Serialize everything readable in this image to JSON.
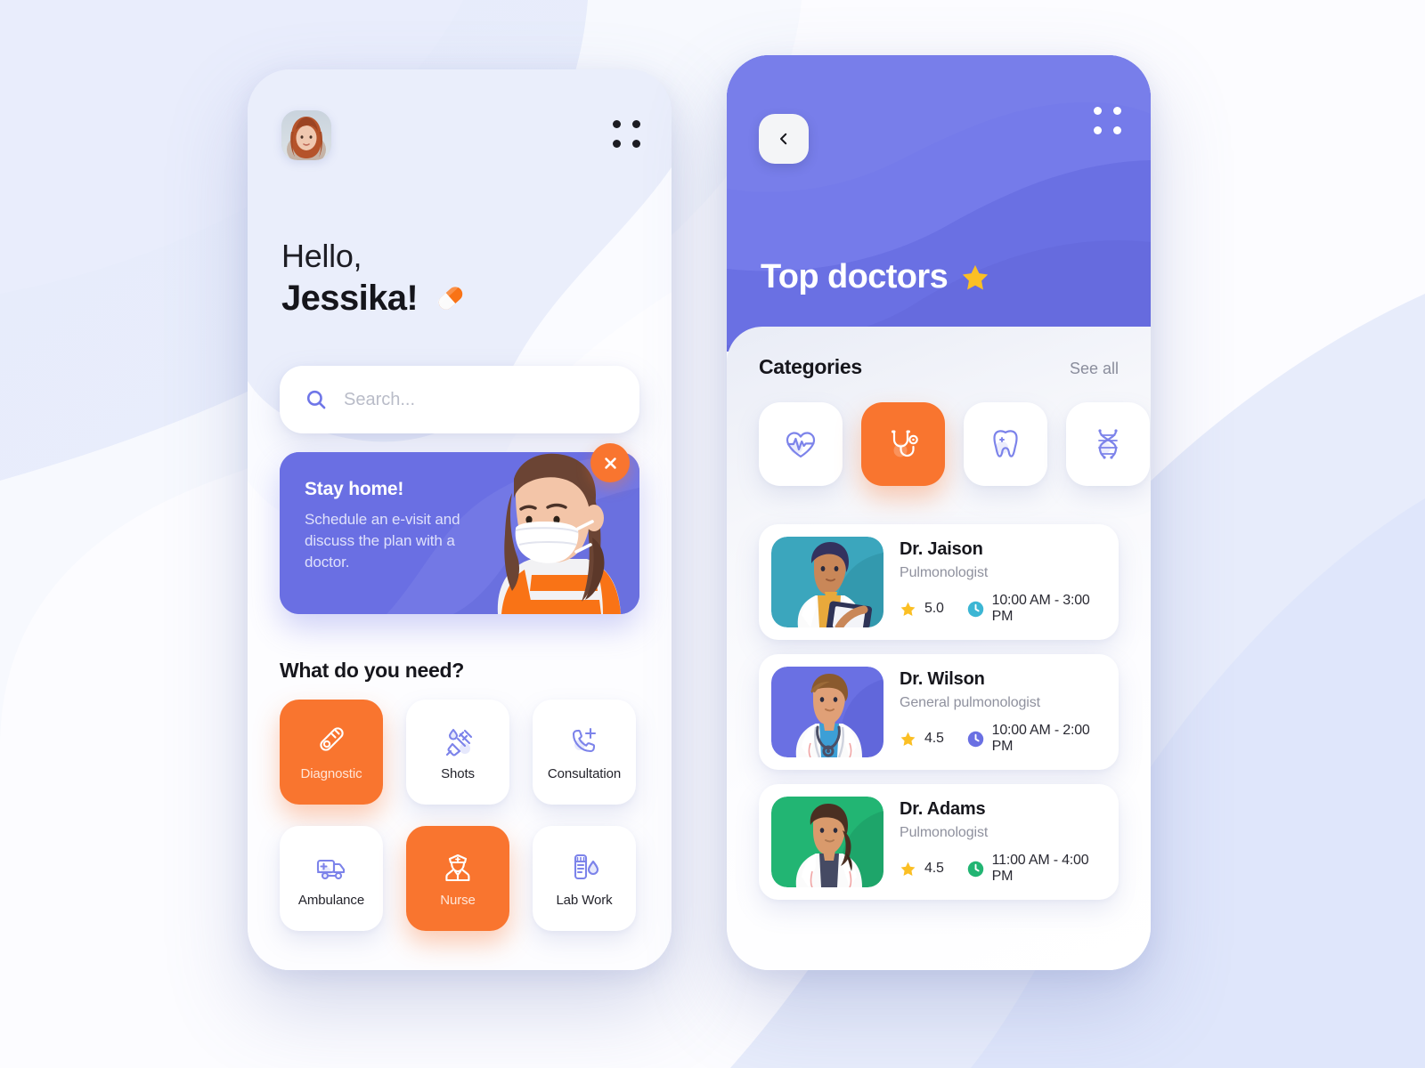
{
  "theme": {
    "background": "#e6ebfb",
    "purple": "#6a70e3",
    "orange": "#f9752f",
    "indigo_icon": "#6f76e8",
    "star_yellow": "#fbbf24",
    "text_dark": "#17171d",
    "text_muted": "#8f919e"
  },
  "left_phone": {
    "avatar_name": "user-avatar-photo",
    "menu_icon": "grid-dots-icon",
    "greeting": {
      "line1": "Hello,",
      "name": "Jessika!",
      "emoji_icon": "pill-icon"
    },
    "search": {
      "placeholder": "Search...",
      "value": "",
      "icon": "search-icon"
    },
    "banner": {
      "title": "Stay home!",
      "subtitle": "Schedule an e-visit and discuss the plan with a doctor.",
      "close_icon": "close-icon",
      "illustration": "masked-girl-illustration"
    },
    "needs_section": {
      "title": "What do you need?",
      "tiles": [
        {
          "label": "Diagnostic",
          "icon": "thermometer-icon",
          "active": true
        },
        {
          "label": "Shots",
          "icon": "syringe-icon",
          "active": false
        },
        {
          "label": "Consultation",
          "icon": "phone-plus-icon",
          "active": false
        },
        {
          "label": "Ambulance",
          "icon": "ambulance-icon",
          "active": false
        },
        {
          "label": "Nurse",
          "icon": "nurse-icon",
          "active": true
        },
        {
          "label": "Lab Work",
          "icon": "test-tube-icon",
          "active": false
        }
      ]
    }
  },
  "right_phone": {
    "back_icon": "chevron-left-icon",
    "menu_icon": "grid-dots-icon",
    "header_title": "Top doctors",
    "header_star_icon": "star-icon",
    "categories": {
      "title": "Categories",
      "see_all_label": "See all",
      "tiles": [
        {
          "icon": "heartbeat-icon",
          "name": "cardiology",
          "active": false
        },
        {
          "icon": "stethoscope-icon",
          "name": "general",
          "active": true
        },
        {
          "icon": "tooth-icon",
          "name": "dental",
          "active": false
        },
        {
          "icon": "dna-icon",
          "name": "genetics",
          "active": false
        }
      ]
    },
    "doctors": [
      {
        "name": "Dr. Jaison",
        "specialty": "Pulmonologist",
        "rating": "5.0",
        "hours": "10:00 AM - 3:00 PM",
        "avatar_bg": "#3ba6bd",
        "clock_color": "#3cb6d4",
        "photo": "doctor-jaison-illustration"
      },
      {
        "name": "Dr. Wilson",
        "specialty": "General pulmonologist",
        "rating": "4.5",
        "hours": "10:00 AM - 2:00 PM",
        "avatar_bg": "#6a70e3",
        "clock_color": "#6a70e3",
        "photo": "doctor-wilson-illustration"
      },
      {
        "name": "Dr. Adams",
        "specialty": "Pulmonologist",
        "rating": "4.5",
        "hours": "11:00 AM - 4:00 PM",
        "avatar_bg": "#22b573",
        "clock_color": "#22b573",
        "photo": "doctor-adams-illustration"
      }
    ]
  }
}
